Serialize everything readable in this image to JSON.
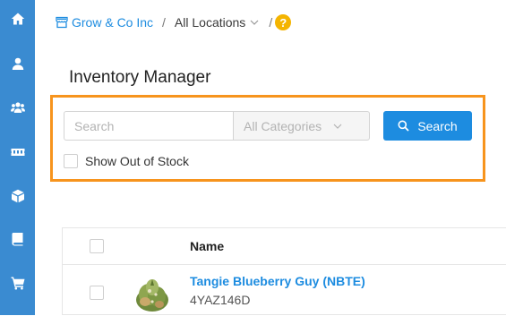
{
  "sidebar": {
    "items": [
      {
        "icon": "home-icon"
      },
      {
        "icon": "user-icon"
      },
      {
        "icon": "users-icon"
      },
      {
        "icon": "ticket-icon"
      },
      {
        "icon": "box-icon"
      },
      {
        "icon": "book-icon"
      },
      {
        "icon": "cart-icon"
      }
    ]
  },
  "breadcrumb": {
    "org": "Grow & Co Inc",
    "separator": "/",
    "location": "All Locations",
    "help": "?"
  },
  "page": {
    "title": "Inventory Manager"
  },
  "filters": {
    "search_placeholder": "Search",
    "search_value": "",
    "category_selected": "All Categories",
    "search_button": "Search",
    "out_of_stock_label": "Show Out of Stock"
  },
  "table": {
    "headers": {
      "name": "Name"
    },
    "rows": [
      {
        "name": "Tangie Blueberry Guy (NBTE)",
        "sku": "4YAZ146D"
      }
    ]
  },
  "colors": {
    "sidebar": "#3a8bd1",
    "accent": "#1d8ce0",
    "highlight_border": "#f7941d",
    "help_badge": "#f4b400"
  }
}
